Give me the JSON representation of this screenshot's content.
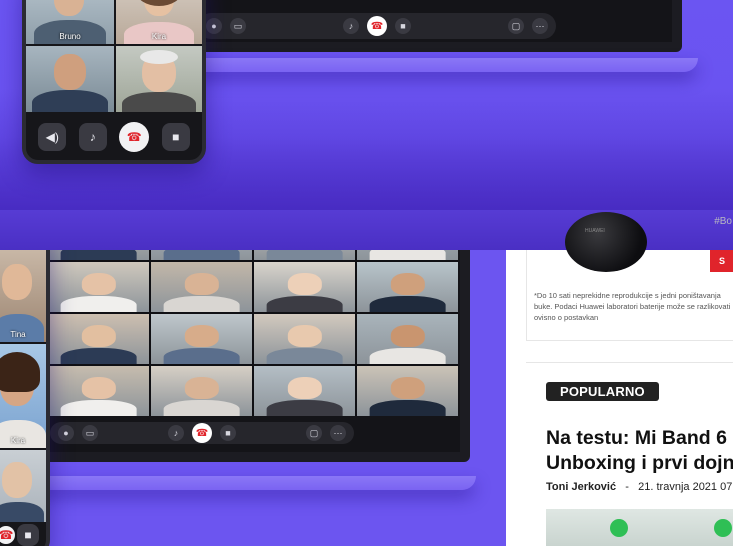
{
  "phone_top": {
    "participants": [
      {
        "name": "Bruno"
      },
      {
        "name": "Kira"
      }
    ]
  },
  "phone_bottom": {
    "participants": [
      {
        "name": "Tina"
      },
      {
        "name": "Kira"
      }
    ]
  },
  "ad": {
    "hashtag": "#Bo",
    "tag": "S",
    "note": "*Do 10 sati neprekidne reprodukcije s jedni poništavanja buke. Podaci Huawei laboratori baterije može se razlikovati ovisno o postavkan",
    "product_brand": "HUAWEI"
  },
  "article": {
    "section_badge": "POPULARNO",
    "headline_line1": "Na testu: Mi Band 6",
    "headline_line2": "Unboxing i prvi dojn",
    "author": "Toni Jerković",
    "separator": "-",
    "date": "21. travnja 2021 07:"
  },
  "colors": {
    "promo_purple": "#6c55f0",
    "end_call_red": "#e0242b",
    "badge_dark": "#222222"
  }
}
